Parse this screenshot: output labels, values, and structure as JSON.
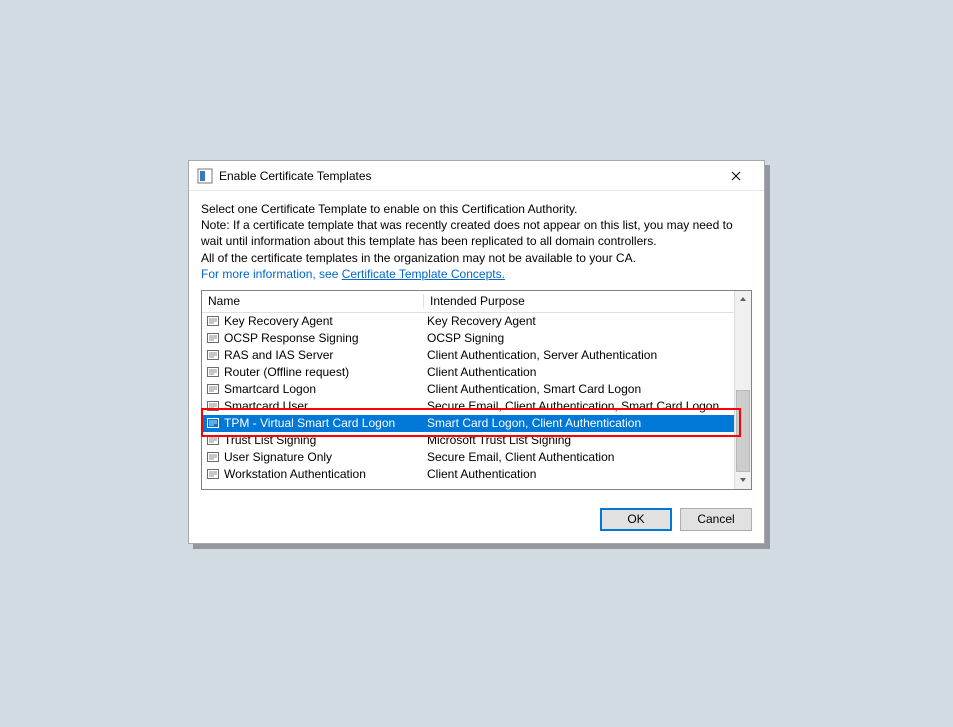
{
  "dialog": {
    "title": "Enable Certificate Templates",
    "close_label": "Close"
  },
  "description": {
    "line1": "Select one Certificate Template to enable on this Certification Authority.",
    "line2": "Note: If a certificate template that was recently created does not appear on this list, you may need to wait until information about this template has been replicated to all domain controllers.",
    "line3": "All of the certificate templates in the organization may not be available to your CA.",
    "more_info_prefix": "For more information, see ",
    "more_info_link": "Certificate Template Concepts."
  },
  "list": {
    "headers": {
      "name": "Name",
      "purpose": "Intended Purpose"
    },
    "rows": [
      {
        "name": "Key Recovery Agent",
        "purpose": "Key Recovery Agent",
        "selected": false
      },
      {
        "name": "OCSP Response Signing",
        "purpose": "OCSP Signing",
        "selected": false
      },
      {
        "name": "RAS and IAS Server",
        "purpose": "Client Authentication, Server Authentication",
        "selected": false
      },
      {
        "name": "Router (Offline request)",
        "purpose": "Client Authentication",
        "selected": false
      },
      {
        "name": "Smartcard Logon",
        "purpose": "Client Authentication, Smart Card Logon",
        "selected": false
      },
      {
        "name": "Smartcard User",
        "purpose": "Secure Email, Client Authentication, Smart Card Logon",
        "selected": false
      },
      {
        "name": "TPM - Virtual Smart Card Logon",
        "purpose": "Smart Card Logon, Client Authentication",
        "selected": true
      },
      {
        "name": "Trust List Signing",
        "purpose": "Microsoft Trust List Signing",
        "selected": false
      },
      {
        "name": "User Signature Only",
        "purpose": "Secure Email, Client Authentication",
        "selected": false
      },
      {
        "name": "Workstation Authentication",
        "purpose": "Client Authentication",
        "selected": false
      }
    ]
  },
  "buttons": {
    "ok": "OK",
    "cancel": "Cancel"
  }
}
